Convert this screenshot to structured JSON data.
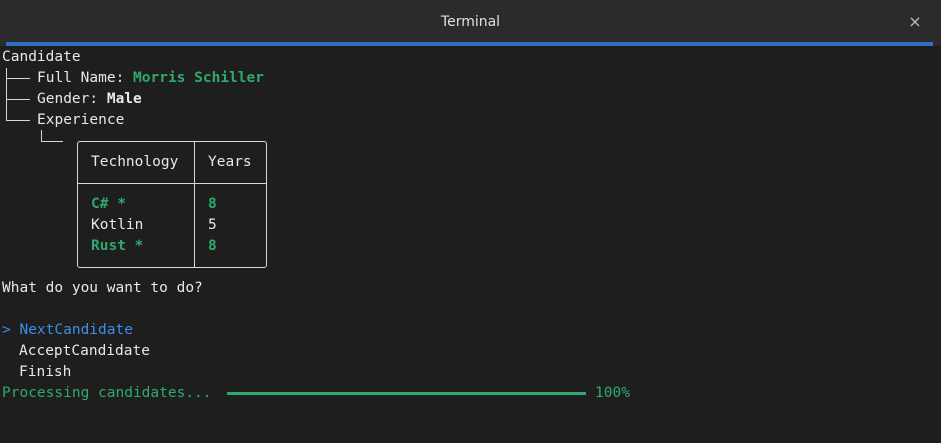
{
  "window": {
    "title": "Terminal",
    "close_glyph": "×"
  },
  "tree": {
    "root": "Candidate",
    "full_name_label": "Full Name: ",
    "full_name_value": "Morris Schiller",
    "gender_label": "Gender: ",
    "gender_value": "Male",
    "experience_label": "Experience"
  },
  "table": {
    "headers": [
      "Technology",
      "Years"
    ],
    "rows": [
      {
        "technology": "C# *",
        "years": "8",
        "highlight": true
      },
      {
        "technology": "Kotlin",
        "years": "5",
        "highlight": false
      },
      {
        "technology": "Rust *",
        "years": "8",
        "highlight": true
      }
    ]
  },
  "prompt": {
    "question": "What do you want to do?",
    "cursor": ">",
    "options": [
      "NextCandidate",
      "AcceptCandidate",
      "Finish"
    ],
    "selected_index": 0
  },
  "progress": {
    "label": "Processing candidates...",
    "percent_text": "100%",
    "value": 1.0
  },
  "colors": {
    "accent": "#2f6fc4",
    "green": "#2eaa6e",
    "selection": "#3b8eea",
    "background": "#1e1e1e"
  }
}
